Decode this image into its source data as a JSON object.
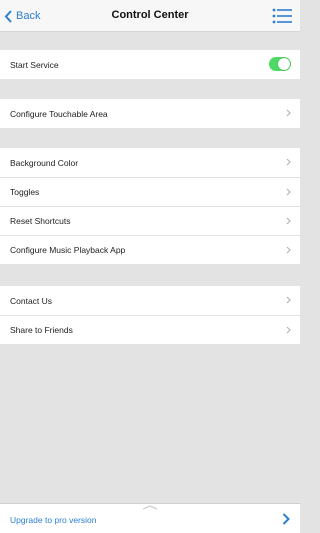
{
  "navbar": {
    "back_label": "Back",
    "title": "Control Center",
    "menu_icon": "list-menu-icon"
  },
  "groups": [
    [
      {
        "label": "Start Service",
        "control": "toggle",
        "state": "on"
      }
    ],
    [
      {
        "label": "Configure Touchable Area",
        "control": "chevron"
      }
    ],
    [
      {
        "label": "Background Color",
        "control": "chevron"
      },
      {
        "label": "Toggles",
        "control": "chevron"
      },
      {
        "label": "Reset Shortcuts",
        "control": "chevron"
      },
      {
        "label": "Configure Music Playback App",
        "control": "chevron"
      }
    ],
    [
      {
        "label": "Contact Us",
        "control": "chevron"
      },
      {
        "label": "Share to Friends",
        "control": "chevron"
      }
    ]
  ],
  "footer": {
    "upgrade_label": "Upgrade to pro version"
  },
  "colors": {
    "accent": "#2b7fd0",
    "toggle_on": "#4cd964",
    "background": "#e3e3e3"
  }
}
